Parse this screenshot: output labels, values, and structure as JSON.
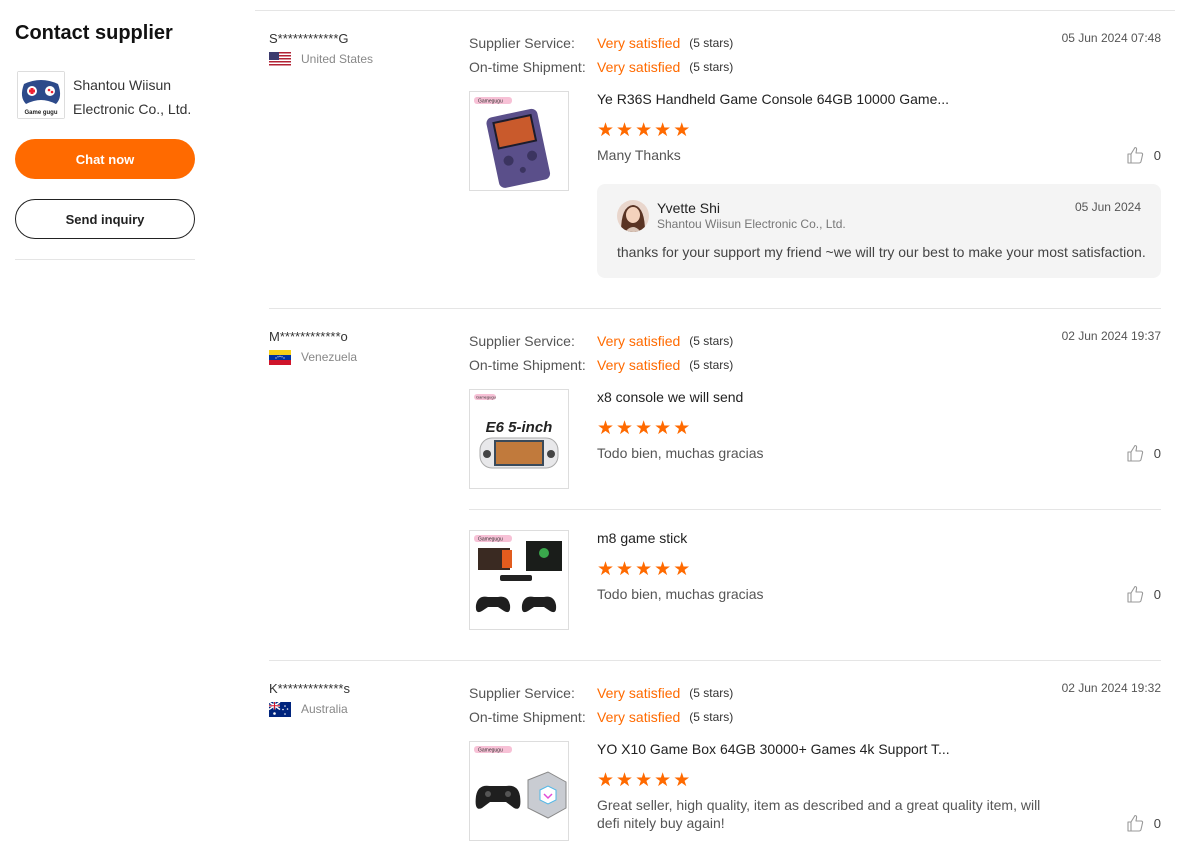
{
  "sidebar": {
    "title": "Contact supplier",
    "supplier_name": "Shantou Wiisun Electronic Co., Ltd.",
    "logo_text": "Game gugu",
    "chat_label": "Chat now",
    "inquiry_label": "Send inquiry"
  },
  "labels": {
    "supplier_service": "Supplier Service:",
    "ontime_shipment": "On-time Shipment:"
  },
  "reviews": [
    {
      "user": "S************G",
      "country": "United States",
      "date": "05 Jun 2024 07:48",
      "supplier_service": "Very satisfied",
      "supplier_service_stars": "(5 stars)",
      "shipment": "Very satisfied",
      "shipment_stars": "(5 stars)",
      "items": [
        {
          "title": "Ye R36S Handheld Game Console 64GB 10000 Game...",
          "rating": 5,
          "text": "Many Thanks",
          "likes": "0",
          "brand": "Gamegugu"
        }
      ],
      "reply": {
        "name": "Yvette Shi",
        "company": "Shantou Wiisun Electronic Co., Ltd.",
        "date": "05 Jun 2024",
        "text": "thanks for your support my friend ~we will try our best to make your most satisfaction."
      }
    },
    {
      "user": "M************o",
      "country": "Venezuela",
      "date": "02 Jun 2024 19:37",
      "supplier_service": "Very satisfied",
      "supplier_service_stars": "(5 stars)",
      "shipment": "Very satisfied",
      "shipment_stars": "(5 stars)",
      "items": [
        {
          "title": "x8 console we will send",
          "rating": 5,
          "text": "Todo bien, muchas gracias",
          "likes": "0",
          "brand": "Gamegugu",
          "image_text": "E6 5-inch"
        },
        {
          "title": "m8 game stick",
          "rating": 5,
          "text": "Todo bien, muchas gracias",
          "likes": "0",
          "brand": "Gamegugu"
        }
      ]
    },
    {
      "user": "K*************s",
      "country": "Australia",
      "date": "02 Jun 2024 19:32",
      "supplier_service": "Very satisfied",
      "supplier_service_stars": "(5 stars)",
      "shipment": "Very satisfied",
      "shipment_stars": "(5 stars)",
      "items": [
        {
          "title": "YO X10 Game Box 64GB 30000+ Games 4k Support T...",
          "rating": 5,
          "text": "Great seller, high quality, item as described and a great quality item, will defi nitely buy again!",
          "likes": "0",
          "brand": "Gamegugu"
        }
      ]
    }
  ],
  "colors": {
    "accent": "#ff6a00",
    "divider": "#e5e5e5",
    "reply_bg": "#f4f4f4"
  },
  "icons": {
    "like": "thumbs-up-icon",
    "star": "star-icon"
  }
}
